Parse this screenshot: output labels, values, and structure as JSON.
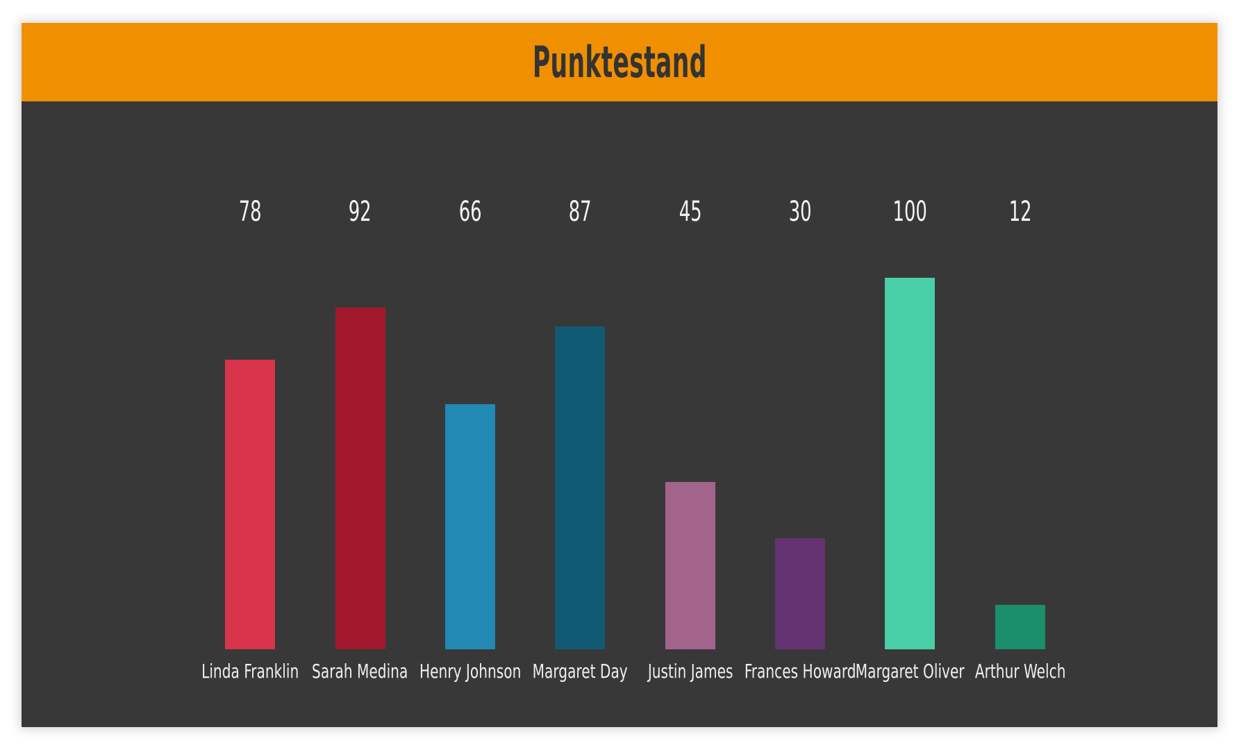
{
  "header": {
    "title": "Punktestand",
    "background_color": "#f09000",
    "title_color": "#333333"
  },
  "plot": {
    "background_color": "#383838"
  },
  "chart_data": {
    "type": "bar",
    "title": "Punktestand",
    "xlabel": "",
    "ylabel": "",
    "ylim": [
      0,
      100
    ],
    "grid": false,
    "legend": "none",
    "value_labels_shown": true,
    "categories": [
      "Linda Franklin",
      "Sarah Medina",
      "Henry Johnson",
      "Margaret Day",
      "Justin James",
      "Frances Howard",
      "Margaret Oliver",
      "Arthur Welch"
    ],
    "values": [
      78,
      92,
      66,
      87,
      45,
      30,
      100,
      12
    ],
    "value_label_strings": [
      "78",
      "92",
      "66",
      "87",
      "45",
      "30",
      "100",
      "12"
    ],
    "colors": [
      "#d9344b",
      "#a4182e",
      "#2189b4",
      "#115a73",
      "#a3648c",
      "#653271",
      "#48cfa7",
      "#1b8f6b"
    ]
  }
}
